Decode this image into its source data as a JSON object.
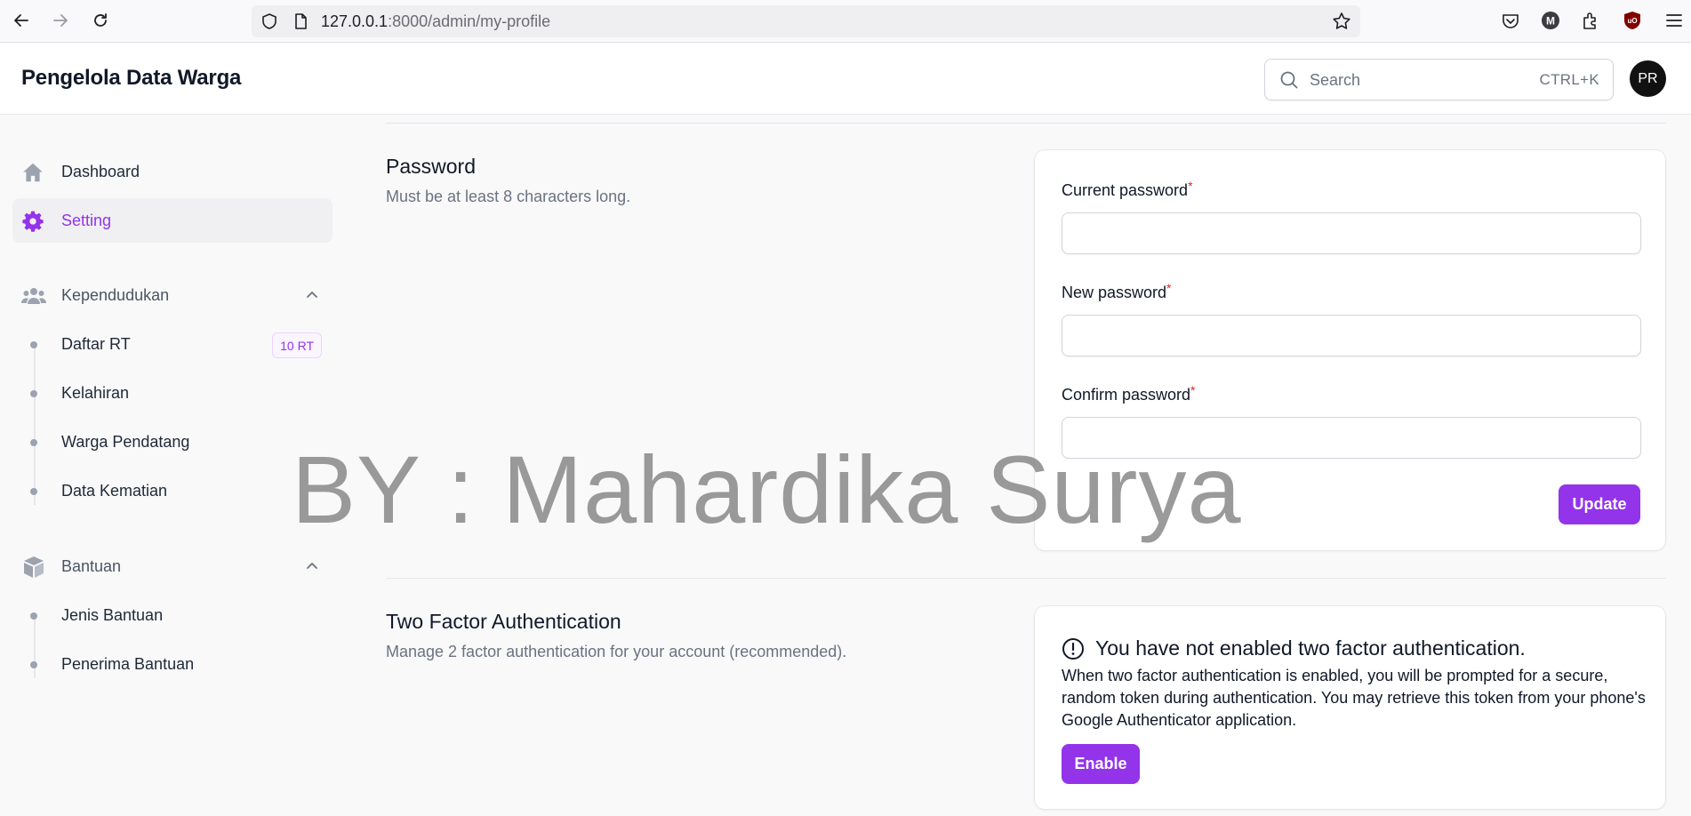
{
  "browser": {
    "url_host": "127.0.0.1",
    "url_path": ":8000/admin/my-profile"
  },
  "header": {
    "brand": "Pengelola Data Warga",
    "search_placeholder": "Search",
    "search_shortcut": "CTRL+K",
    "avatar_initials": "PR"
  },
  "sidebar": {
    "items": [
      {
        "label": "Dashboard",
        "icon": "home-icon"
      },
      {
        "label": "Setting",
        "icon": "gear-icon",
        "active": true
      }
    ],
    "groups": [
      {
        "label": "Kependudukan",
        "icon": "users-icon",
        "items": [
          {
            "label": "Daftar RT",
            "badge": "10 RT"
          },
          {
            "label": "Kelahiran"
          },
          {
            "label": "Warga Pendatang"
          },
          {
            "label": "Data Kematian"
          }
        ]
      },
      {
        "label": "Bantuan",
        "icon": "cube-icon",
        "items": [
          {
            "label": "Jenis Bantuan"
          },
          {
            "label": "Penerima Bantuan"
          }
        ]
      }
    ]
  },
  "password_section": {
    "title": "Password",
    "description": "Must be at least 8 characters long.",
    "fields": [
      {
        "label": "Current password",
        "required_mark": "*"
      },
      {
        "label": "New password",
        "required_mark": "*"
      },
      {
        "label": "Confirm password",
        "required_mark": "*"
      }
    ],
    "submit_label": "Update"
  },
  "tfa_section": {
    "title": "Two Factor Authentication",
    "description": "Manage 2 factor authentication for your account (recommended).",
    "status_title": "You have not enabled two factor authentication.",
    "status_text": "When two factor authentication is enabled, you will be prompted for a secure, random token during authentication. You may retrieve this token from your phone's Google Authenticator application.",
    "enable_label": "Enable"
  },
  "watermark": "BY : Mahardika Surya",
  "colors": {
    "accent": "#9333ea",
    "required": "#dc2626"
  }
}
